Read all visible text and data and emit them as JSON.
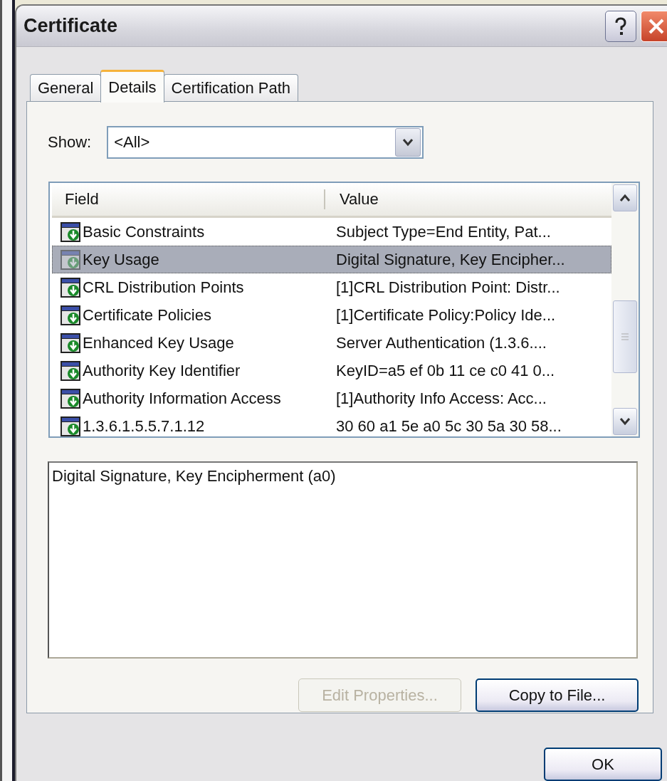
{
  "window": {
    "title": "Certificate"
  },
  "tabs": [
    {
      "label": "General",
      "selected": false
    },
    {
      "label": "Details",
      "selected": true
    },
    {
      "label": "Certification Path",
      "selected": false
    }
  ],
  "show": {
    "label": "Show:",
    "value": "<All>"
  },
  "table": {
    "columns": [
      "Field",
      "Value"
    ],
    "rows": [
      {
        "field": "Basic Constraints",
        "value": "Subject Type=End Entity, Pat...",
        "selected": false
      },
      {
        "field": "Key Usage",
        "value": "Digital Signature, Key Encipher...",
        "selected": true
      },
      {
        "field": "CRL Distribution Points",
        "value": "[1]CRL Distribution Point: Distr...",
        "selected": false
      },
      {
        "field": "Certificate Policies",
        "value": "[1]Certificate Policy:Policy Ide...",
        "selected": false
      },
      {
        "field": "Enhanced Key Usage",
        "value": "Server Authentication (1.3.6....",
        "selected": false
      },
      {
        "field": "Authority Key Identifier",
        "value": "KeyID=a5 ef 0b 11 ce c0 41 0...",
        "selected": false
      },
      {
        "field": "Authority Information Access",
        "value": "[1]Authority Info Access: Acc...",
        "selected": false
      },
      {
        "field": "1.3.6.1.5.5.7.1.12",
        "value": "30 60 a1 5e a0 5c 30 5a 30 58...",
        "selected": false
      }
    ]
  },
  "detail_text": "Digital Signature, Key Encipherment (a0)",
  "buttons": [
    {
      "label": "Edit Properties...",
      "disabled": true
    },
    {
      "label": "Copy to File...",
      "disabled": false
    }
  ],
  "ok_button": {
    "label": "OK"
  }
}
